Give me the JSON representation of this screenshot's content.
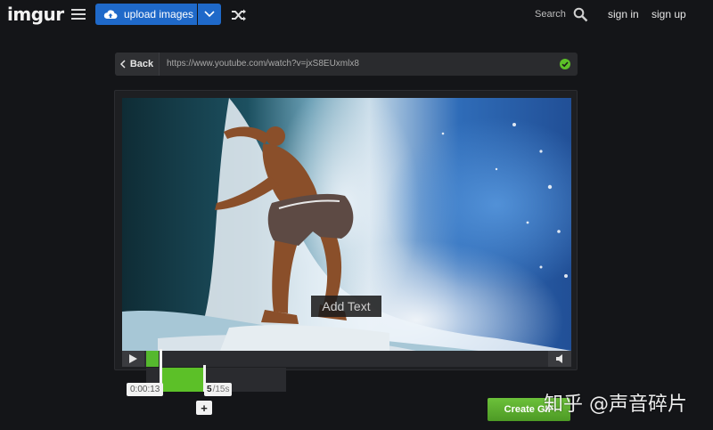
{
  "header": {
    "logo": "imgur",
    "upload_label": "upload images",
    "search_label": "Search",
    "signin_label": "sign in",
    "signup_label": "sign up"
  },
  "urlbar": {
    "back_label": "Back",
    "url": "https://www.youtube.com/watch?v=jxS8EUxmlx8",
    "valid_color": "#5cc028"
  },
  "video": {
    "add_text_label": "Add Text",
    "progress_fraction": 0.03
  },
  "trimmer": {
    "start_time": "0:00:13",
    "duration_value": "5",
    "duration_max": "/15s",
    "range_fraction_of_track": 0.31
  },
  "actions": {
    "create_label": "Create GIF"
  },
  "watermark": "知乎 @声音碎片",
  "colors": {
    "accent_blue": "#1f69c9",
    "accent_green": "#5cc028",
    "background": "#141518"
  }
}
